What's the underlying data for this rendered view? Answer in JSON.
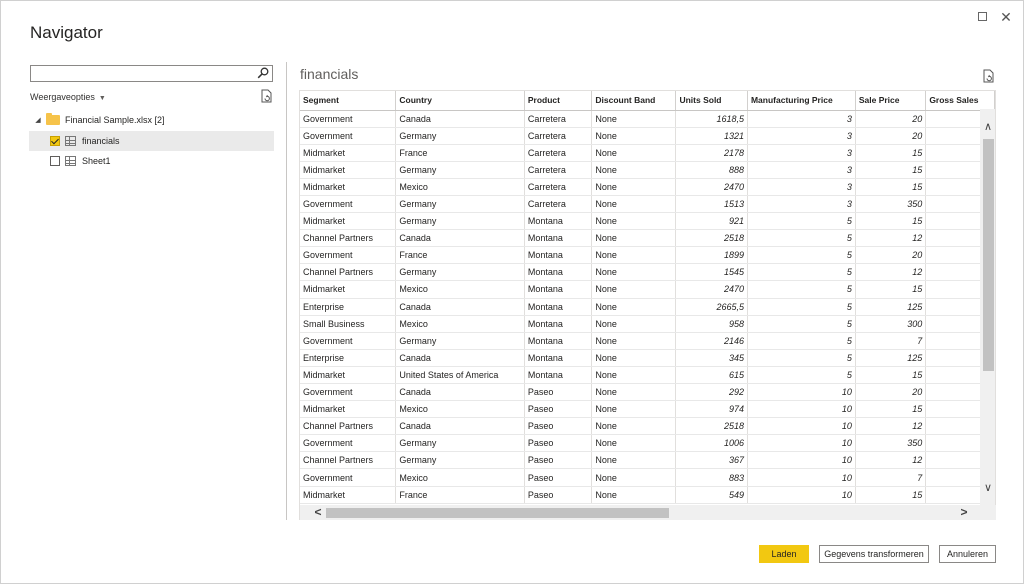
{
  "window": {
    "title": "Navigator"
  },
  "left": {
    "search": {
      "value": "",
      "placeholder": ""
    },
    "options_label": "Weergaveopties",
    "tree": [
      {
        "label": "Financial Sample.xlsx [2]",
        "type": "file",
        "expanded": true
      },
      {
        "label": "financials",
        "type": "table",
        "checked": true,
        "selected": true
      },
      {
        "label": "Sheet1",
        "type": "table",
        "checked": false,
        "selected": false
      }
    ]
  },
  "preview": {
    "title": "financials",
    "columns": [
      "Segment",
      "Country",
      "Product",
      "Discount Band",
      "Units Sold",
      "Manufacturing Price",
      "Sale Price",
      "Gross Sales"
    ],
    "rows": [
      [
        "Government",
        "Canada",
        "Carretera",
        "None",
        "1618,5",
        "3",
        "20",
        ""
      ],
      [
        "Government",
        "Germany",
        "Carretera",
        "None",
        "1321",
        "3",
        "20",
        ""
      ],
      [
        "Midmarket",
        "France",
        "Carretera",
        "None",
        "2178",
        "3",
        "15",
        ""
      ],
      [
        "Midmarket",
        "Germany",
        "Carretera",
        "None",
        "888",
        "3",
        "15",
        ""
      ],
      [
        "Midmarket",
        "Mexico",
        "Carretera",
        "None",
        "2470",
        "3",
        "15",
        ""
      ],
      [
        "Government",
        "Germany",
        "Carretera",
        "None",
        "1513",
        "3",
        "350",
        ""
      ],
      [
        "Midmarket",
        "Germany",
        "Montana",
        "None",
        "921",
        "5",
        "15",
        ""
      ],
      [
        "Channel Partners",
        "Canada",
        "Montana",
        "None",
        "2518",
        "5",
        "12",
        ""
      ],
      [
        "Government",
        "France",
        "Montana",
        "None",
        "1899",
        "5",
        "20",
        ""
      ],
      [
        "Channel Partners",
        "Germany",
        "Montana",
        "None",
        "1545",
        "5",
        "12",
        ""
      ],
      [
        "Midmarket",
        "Mexico",
        "Montana",
        "None",
        "2470",
        "5",
        "15",
        ""
      ],
      [
        "Enterprise",
        "Canada",
        "Montana",
        "None",
        "2665,5",
        "5",
        "125",
        ""
      ],
      [
        "Small Business",
        "Mexico",
        "Montana",
        "None",
        "958",
        "5",
        "300",
        ""
      ],
      [
        "Government",
        "Germany",
        "Montana",
        "None",
        "2146",
        "5",
        "7",
        ""
      ],
      [
        "Enterprise",
        "Canada",
        "Montana",
        "None",
        "345",
        "5",
        "125",
        ""
      ],
      [
        "Midmarket",
        "United States of America",
        "Montana",
        "None",
        "615",
        "5",
        "15",
        ""
      ],
      [
        "Government",
        "Canada",
        "Paseo",
        "None",
        "292",
        "10",
        "20",
        ""
      ],
      [
        "Midmarket",
        "Mexico",
        "Paseo",
        "None",
        "974",
        "10",
        "15",
        ""
      ],
      [
        "Channel Partners",
        "Canada",
        "Paseo",
        "None",
        "2518",
        "10",
        "12",
        ""
      ],
      [
        "Government",
        "Germany",
        "Paseo",
        "None",
        "1006",
        "10",
        "350",
        ""
      ],
      [
        "Channel Partners",
        "Germany",
        "Paseo",
        "None",
        "367",
        "10",
        "12",
        ""
      ],
      [
        "Government",
        "Mexico",
        "Paseo",
        "None",
        "883",
        "10",
        "7",
        ""
      ],
      [
        "Midmarket",
        "France",
        "Paseo",
        "None",
        "549",
        "10",
        "15",
        ""
      ]
    ]
  },
  "buttons": {
    "load": "Laden",
    "transform": "Gegevens transformeren",
    "cancel": "Annuleren"
  },
  "colors": {
    "accent": "#f2c811",
    "folder": "#f6c34a"
  }
}
